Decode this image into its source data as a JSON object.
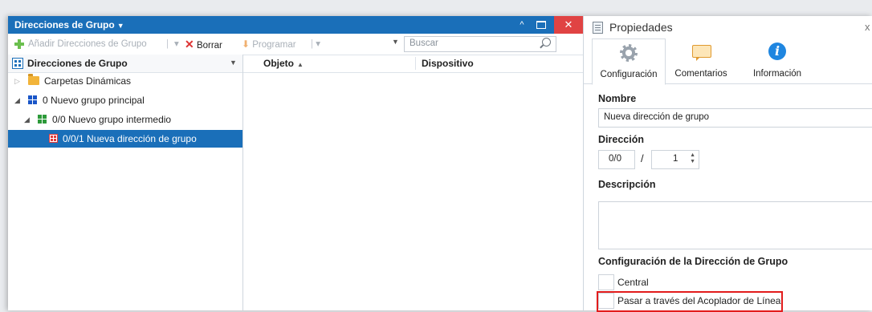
{
  "left_window": {
    "title": "Direcciones de Grupo",
    "title_caret": "▼",
    "window_buttons": {
      "up": "^",
      "close": "✕"
    },
    "toolbar": {
      "add_label": "Añadir Direcciones de Grupo",
      "delete_label": "Borrar",
      "program_label": "Programar",
      "search_placeholder": "Buscar"
    },
    "tree": {
      "header": "Direcciones de Grupo",
      "items": [
        {
          "label": "Carpetas Dinámicas",
          "expander": "▷"
        },
        {
          "label": "0 Nuevo grupo principal",
          "expander": "◢"
        },
        {
          "label": "0/0 Nuevo grupo intermedio",
          "expander": "◢"
        },
        {
          "label": "0/0/1 Nueva dirección de grupo",
          "expander": ""
        }
      ]
    },
    "columns": {
      "object": "Objeto",
      "object_sort": "▲",
      "device": "Dispositivo"
    }
  },
  "properties": {
    "title": "Propiedades",
    "close": "x",
    "tabs": [
      {
        "label": "Configuración",
        "icon": "gear-icon",
        "active": true
      },
      {
        "label": "Comentarios",
        "icon": "comment-icon",
        "active": false
      },
      {
        "label": "Información",
        "icon": "info-icon",
        "active": false
      }
    ],
    "name_label": "Nombre",
    "name_value": "Nueva dirección de grupo",
    "address_label": "Dirección",
    "address_prefix": "0/0",
    "address_separator": "/",
    "address_value": "1",
    "description_label": "Descripción",
    "group_config_label": "Configuración de la Dirección de Grupo",
    "checkbox_central": "Central",
    "checkbox_pass_through": "Pasar a través del Acoplador de Línea"
  },
  "colors": {
    "accent": "#1a6fb9",
    "close_red": "#e04343",
    "highlight_red": "#e21c1c"
  }
}
